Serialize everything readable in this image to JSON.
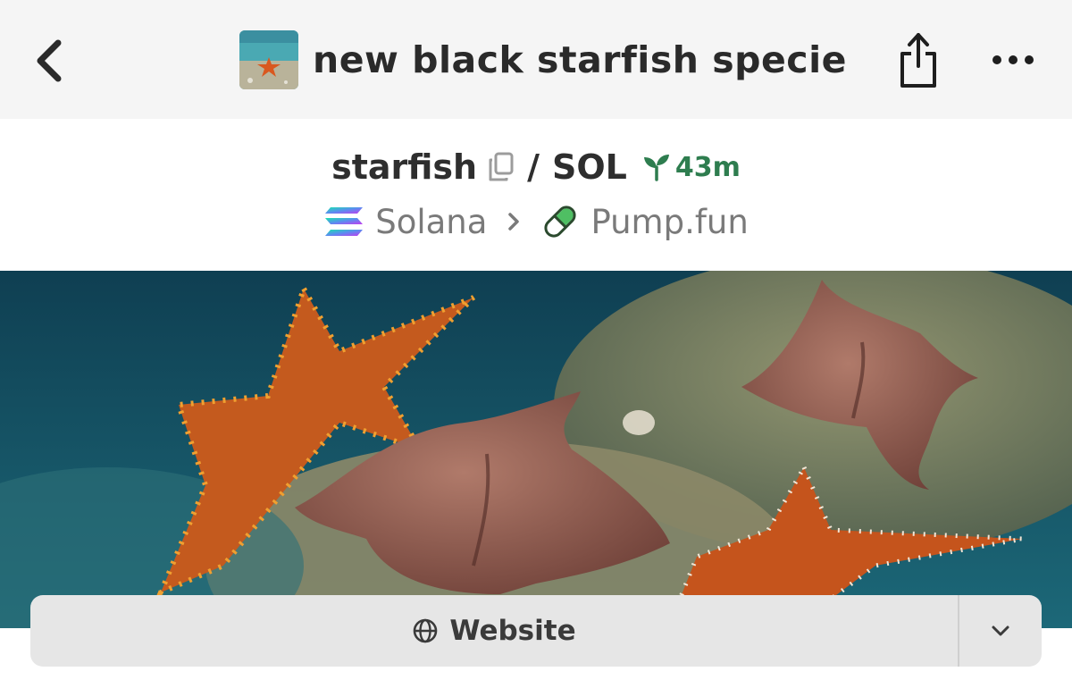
{
  "header": {
    "title": "new black starfish specie",
    "back_icon": "chevron-left-icon",
    "share_icon": "share-icon",
    "more_icon": "more-horizontal-icon"
  },
  "pair": {
    "base_symbol": "starfish",
    "separator": "/",
    "quote_symbol": "SOL",
    "age": "43m",
    "age_icon": "seedling-icon",
    "age_color": "#2e7d4f"
  },
  "chain": {
    "name": "Solana",
    "dex": "Pump.fun",
    "chain_icon": "solana-icon",
    "dex_icon": "pill-icon"
  },
  "links": {
    "website_label": "Website",
    "website_icon": "globe-icon",
    "dropdown_icon": "chevron-down-icon"
  }
}
